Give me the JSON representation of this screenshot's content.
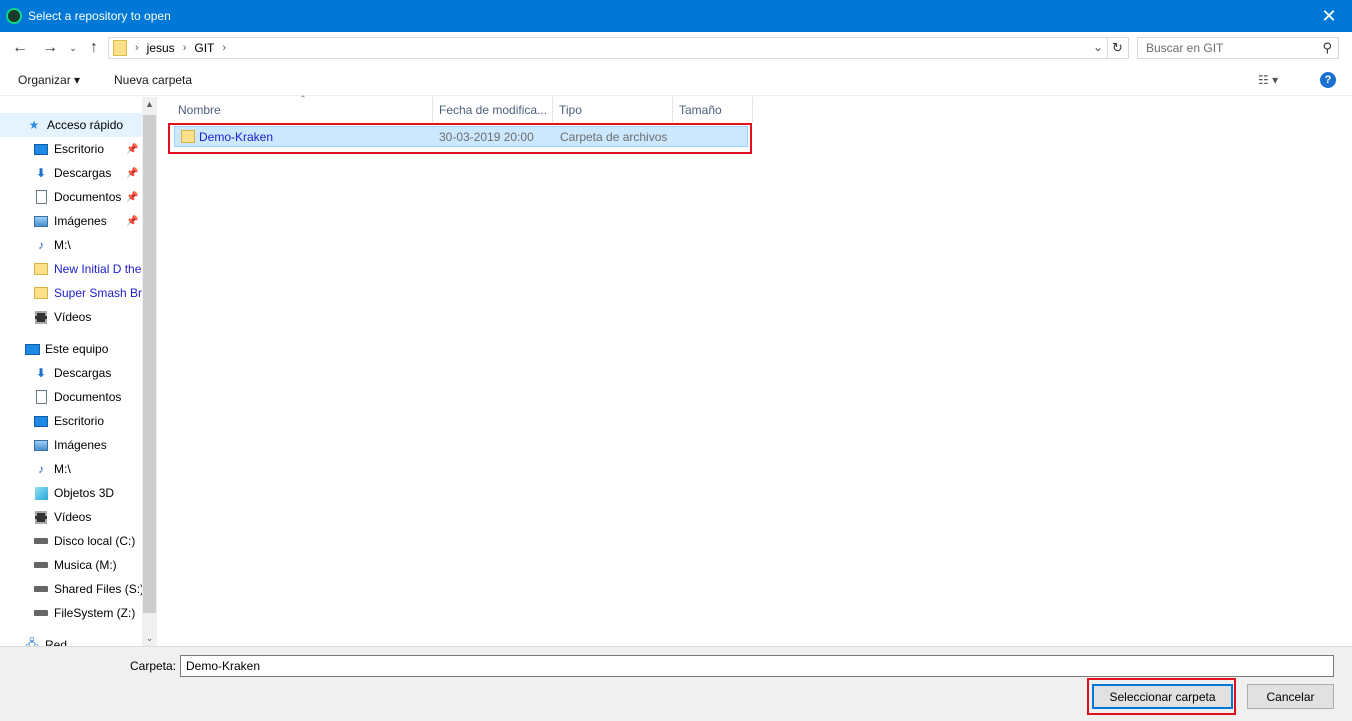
{
  "window": {
    "title": "Select a repository to open",
    "close_glyph": "✕"
  },
  "address": {
    "crumbs": [
      "jesus",
      "GIT"
    ],
    "search_placeholder": "Buscar en GIT"
  },
  "toolbar": {
    "organize": "Organizar ▾",
    "new_folder": "Nueva carpeta"
  },
  "sidebar": {
    "items": [
      {
        "label": "Acceso rápido",
        "icon": "star-icon"
      },
      {
        "label": "Escritorio",
        "icon": "desktop-icon"
      },
      {
        "label": "Descargas",
        "icon": "download-icon"
      },
      {
        "label": "Documentos",
        "icon": "document-icon"
      },
      {
        "label": "Imágenes",
        "icon": "pictures-icon"
      },
      {
        "label": "M:\\",
        "icon": "music-icon"
      },
      {
        "label": "New Initial D the",
        "icon": "folder-icon"
      },
      {
        "label": "Super Smash Bro",
        "icon": "folder-icon"
      },
      {
        "label": "Vídeos",
        "icon": "video-icon"
      },
      {
        "label": "Este equipo",
        "icon": "computer-icon"
      },
      {
        "label": "Descargas",
        "icon": "download-icon"
      },
      {
        "label": "Documentos",
        "icon": "document-icon"
      },
      {
        "label": "Escritorio",
        "icon": "desktop-icon"
      },
      {
        "label": "Imágenes",
        "icon": "pictures-icon"
      },
      {
        "label": "M:\\",
        "icon": "music-icon"
      },
      {
        "label": "Objetos 3D",
        "icon": "3d-objects-icon"
      },
      {
        "label": "Vídeos",
        "icon": "video-icon"
      },
      {
        "label": "Disco local (C:)",
        "icon": "drive-icon"
      },
      {
        "label": "Musica (M:)",
        "icon": "drive-icon"
      },
      {
        "label": "Shared Files (S:)",
        "icon": "drive-icon"
      },
      {
        "label": "FileSystem (Z:)",
        "icon": "drive-icon"
      },
      {
        "label": "Red",
        "icon": "network-icon"
      }
    ]
  },
  "columns": [
    "Nombre",
    "Fecha de modifica...",
    "Tipo",
    "Tamaño"
  ],
  "files": [
    {
      "name": "Demo-Kraken",
      "date": "30-03-2019 20:00",
      "type": "Carpeta de archivos",
      "size": ""
    }
  ],
  "footer": {
    "folder_label": "Carpeta:",
    "folder_value": "Demo-Kraken",
    "select_button": "Seleccionar carpeta",
    "cancel_button": "Cancelar"
  },
  "colors": {
    "titlebar": "#0078d7",
    "selection": "#cce8ff",
    "highlight_frame": "#e0101e"
  }
}
